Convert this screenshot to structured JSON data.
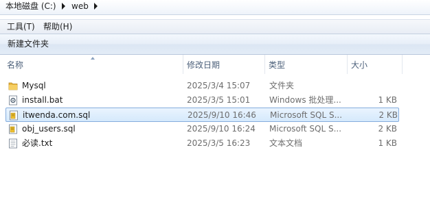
{
  "address": {
    "segments": [
      "本地磁盘 (C:)",
      "web"
    ]
  },
  "menu": {
    "items": [
      "工具(T)",
      "帮助(H)"
    ]
  },
  "toolbar": {
    "new_folder": "新建文件夹"
  },
  "columns": {
    "name": "名称",
    "date": "修改日期",
    "type": "类型",
    "size": "大小"
  },
  "files": [
    {
      "name": "Mysql",
      "date": "2025/3/4 15:07",
      "type": "文件夹",
      "size": "",
      "icon": "folder-icon"
    },
    {
      "name": "install.bat",
      "date": "2025/3/5 15:01",
      "type": "Windows 批处理...",
      "size": "1 KB",
      "icon": "batch-file-icon"
    },
    {
      "name": "itwenda.com.sql",
      "date": "2025/9/10 16:46",
      "type": "Microsoft SQL S...",
      "size": "2 KB",
      "icon": "sql-file-icon",
      "selected": true
    },
    {
      "name": "obj_users.sql",
      "date": "2025/9/10 16:24",
      "type": "Microsoft SQL S...",
      "size": "2 KB",
      "icon": "sql-file-icon"
    },
    {
      "name": "必读.txt",
      "date": "2025/3/5 16:23",
      "type": "文本文档",
      "size": "1 KB",
      "icon": "text-file-icon"
    }
  ],
  "colors": {
    "selection_border": "#84acdd",
    "selection_fill": "#d5e9fc",
    "folder": "#e8b640"
  }
}
